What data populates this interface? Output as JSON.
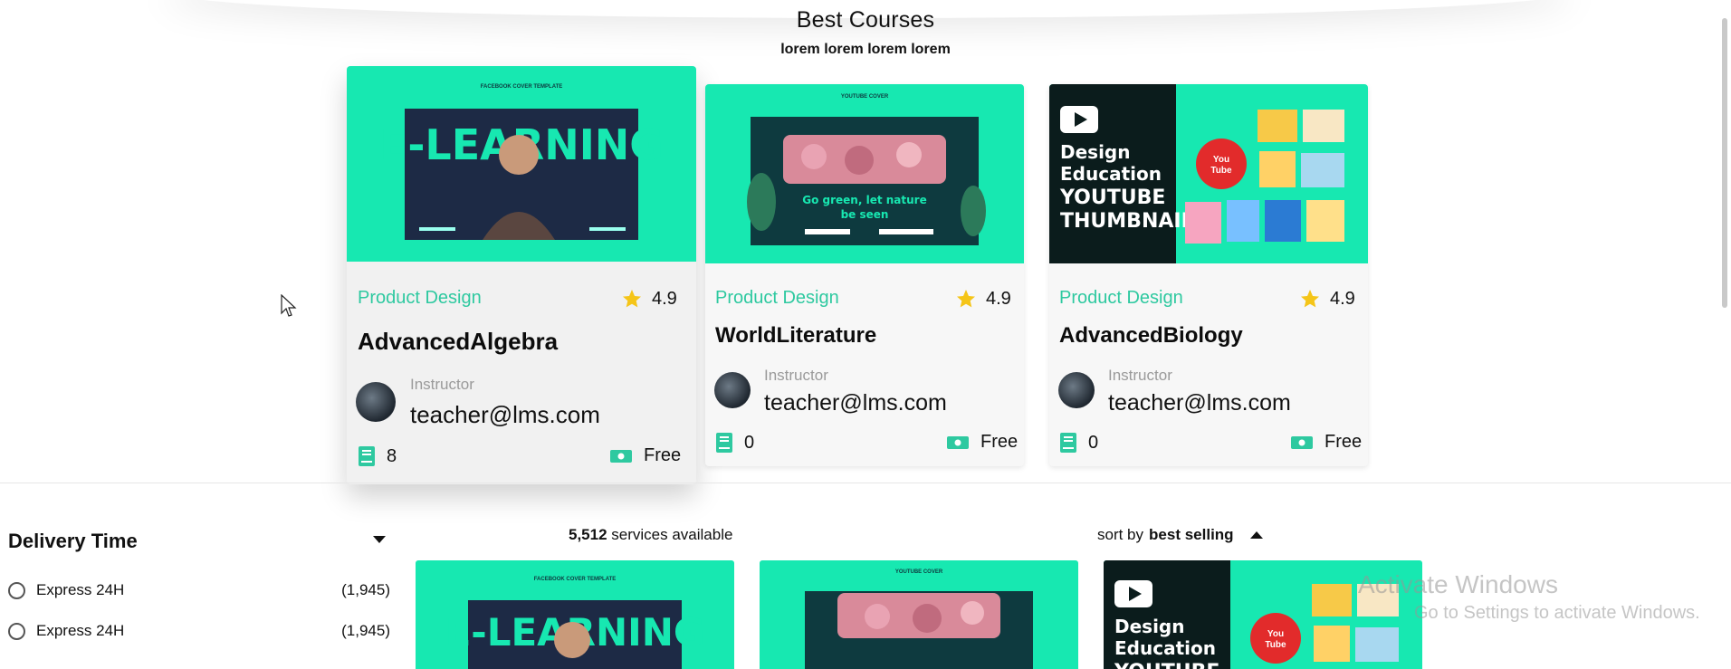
{
  "header": {
    "title": "Best Courses",
    "subtitle": "lorem lorem lorem lorem"
  },
  "courses": [
    {
      "category": "Product Design",
      "rating": "4.9",
      "title": "AdvancedAlgebra",
      "instructor_label": "Instructor",
      "instructor_email": "teacher@lms.com",
      "lessons": "8",
      "price": "Free",
      "thumbnail": {
        "headline": "E-LEARNING",
        "top_label": "FACEBOOK COVER TEMPLATE"
      }
    },
    {
      "category": "Product Design",
      "rating": "4.9",
      "title": "WorldLiterature",
      "instructor_label": "Instructor",
      "instructor_email": "teacher@lms.com",
      "lessons": "0",
      "price": "Free",
      "thumbnail": {
        "headline": "Go green, let nature be seen",
        "top_label": "YOUTUBE COVER"
      }
    },
    {
      "category": "Product Design",
      "rating": "4.9",
      "title": "AdvancedBiology",
      "instructor_label": "Instructor",
      "instructor_email": "teacher@lms.com",
      "lessons": "0",
      "price": "Free",
      "thumbnail": {
        "headline_lines": [
          "Design",
          "Education",
          "YOUTUBE",
          "THUMBNAIL"
        ],
        "badge": "You Tube"
      }
    }
  ],
  "filters": {
    "title": "Delivery Time",
    "options": [
      {
        "label": "Express 24H",
        "count": "(1,945)"
      },
      {
        "label": "Express 24H",
        "count": "(1,945)"
      }
    ]
  },
  "listing": {
    "services_count": "5,512",
    "services_suffix": " services available",
    "sort_prefix": "sort by ",
    "sort_value": "best selling"
  },
  "watermark": {
    "line1": "Activate Windows",
    "line2": "Go to Settings to activate Windows."
  },
  "colors": {
    "accent": "#2ec9a0",
    "thumb_green": "#17e8b1",
    "thumb_dark": "#0e3a3f",
    "star": "#f5c518"
  }
}
